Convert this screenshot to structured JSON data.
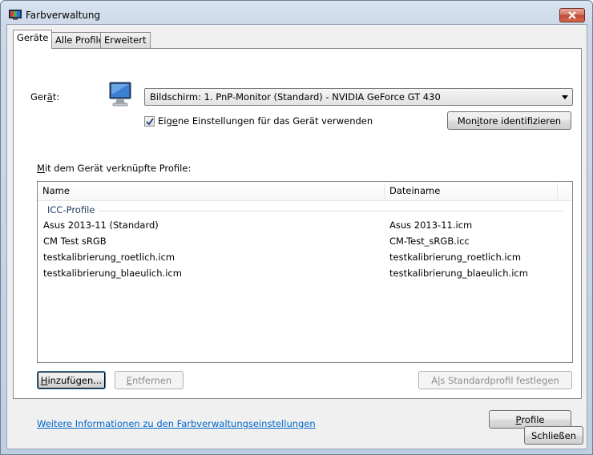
{
  "window": {
    "title": "Farbverwaltung",
    "close_icon": "close-icon"
  },
  "tabs": [
    {
      "label": "Geräte",
      "active": true
    },
    {
      "label": "Alle Profile",
      "active": false
    },
    {
      "label": "Erweitert",
      "active": false
    }
  ],
  "device": {
    "label_pre": "Ger",
    "label_u": "ä",
    "label_post": "t:",
    "icon": "monitor-icon",
    "selected": "Bildschirm: 1. PnP-Monitor (Standard) - NVIDIA GeForce GT 430",
    "use_own_settings_pre": "Eig",
    "use_own_settings_u": "e",
    "use_own_settings_post": "ne Einstellungen für das Gerät verwenden",
    "use_own_settings_checked": true,
    "identify_button_pre": "Mon",
    "identify_button_u": "i",
    "identify_button_post": "tore identifizieren"
  },
  "profiles": {
    "section_label_u": "M",
    "section_label_post": "it dem Gerät verknüpfte Profile:",
    "columns": [
      "Name",
      "Dateiname"
    ],
    "group": "ICC-Profile",
    "rows": [
      {
        "name": "Asus 2013-11 (Standard)",
        "file": "Asus 2013-11.icm"
      },
      {
        "name": "CM Test sRGB",
        "file": "CM-Test_sRGB.icc"
      },
      {
        "name": "testkalibrierung_roetlich.icm",
        "file": "testkalibrierung_roetlich.icm"
      },
      {
        "name": "testkalibrierung_blaeulich.icm",
        "file": "testkalibrierung_blaeulich.icm"
      }
    ]
  },
  "buttons": {
    "add_u": "H",
    "add_post": "inzufügen...",
    "remove_u": "E",
    "remove_post": "ntfernen",
    "set_default_pre": "A",
    "set_default_u": "l",
    "set_default_post": "s Standardprofil festlegen",
    "profiles_u": "P",
    "profiles_post": "rofile",
    "close": "Schließen"
  },
  "link": "Weitere Informationen zu den Farbverwaltungseinstellungen"
}
